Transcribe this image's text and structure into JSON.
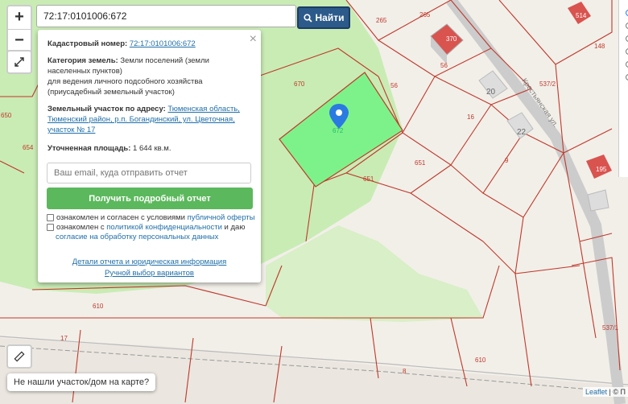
{
  "search": {
    "value": "72:17:0101006:672",
    "button_label": "Найти"
  },
  "zoom": {
    "in": "+",
    "out": "−"
  },
  "popup": {
    "cadastral_label": "Кадастровый номер:",
    "cadastral_number": "72:17:0101006:672",
    "category_label": "Категория земель:",
    "category_value": "Земли поселений (земли населенных пунктов)",
    "usage": "для ведения личного подсобного хозяйства (приусадебный земельный участок)",
    "address_label": "Земельный участок по адресу:",
    "address_value": "Тюменская область, Тюменский район, р.п. Богандинский, ул. Цветочная, участок № 17",
    "area_label": "Уточненная площадь:",
    "area_value": "1 644 кв.м.",
    "email_placeholder": "Ваш email, куда отправить отчет",
    "report_button": "Получить подробный отчет",
    "agree1_prefix": "ознакомлен и согласен с условиями ",
    "agree1_link": "публичной оферты",
    "agree2_prefix": "ознакомлен с ",
    "agree2_link": "политикой конфиденциальности",
    "agree2_mid": " и даю ",
    "agree2_link2": "согласие на обработку персональных данных",
    "details_link": "Детали отчета и юридическая информация",
    "manual_link": "Ручной выбор вариантов"
  },
  "not_found": "Не нашли участок/дом на карте?",
  "attribution": {
    "leaflet": "Leaflet",
    "rest": " | © П"
  },
  "map_labels": {
    "parcels": [
      "265",
      "265",
      "670",
      "672",
      "56",
      "56",
      "370",
      "20",
      "16",
      "22",
      "9",
      "537/2",
      "148",
      "651",
      "651",
      "654",
      "650",
      "610",
      "610",
      "17",
      "8",
      "195",
      "537/1",
      "514"
    ],
    "street": "Крестьянская ул."
  },
  "colors": {
    "parcel_line": "#c0392b",
    "selected": "#7ef28a",
    "green_area": "#c9ecb5",
    "button_blue": "#2c5a8a",
    "report_green": "#5cb85c"
  },
  "icons": [
    "plus-icon",
    "minus-icon",
    "fullscreen-icon",
    "search-icon",
    "ruler-icon",
    "close-icon",
    "map-marker-icon"
  ]
}
